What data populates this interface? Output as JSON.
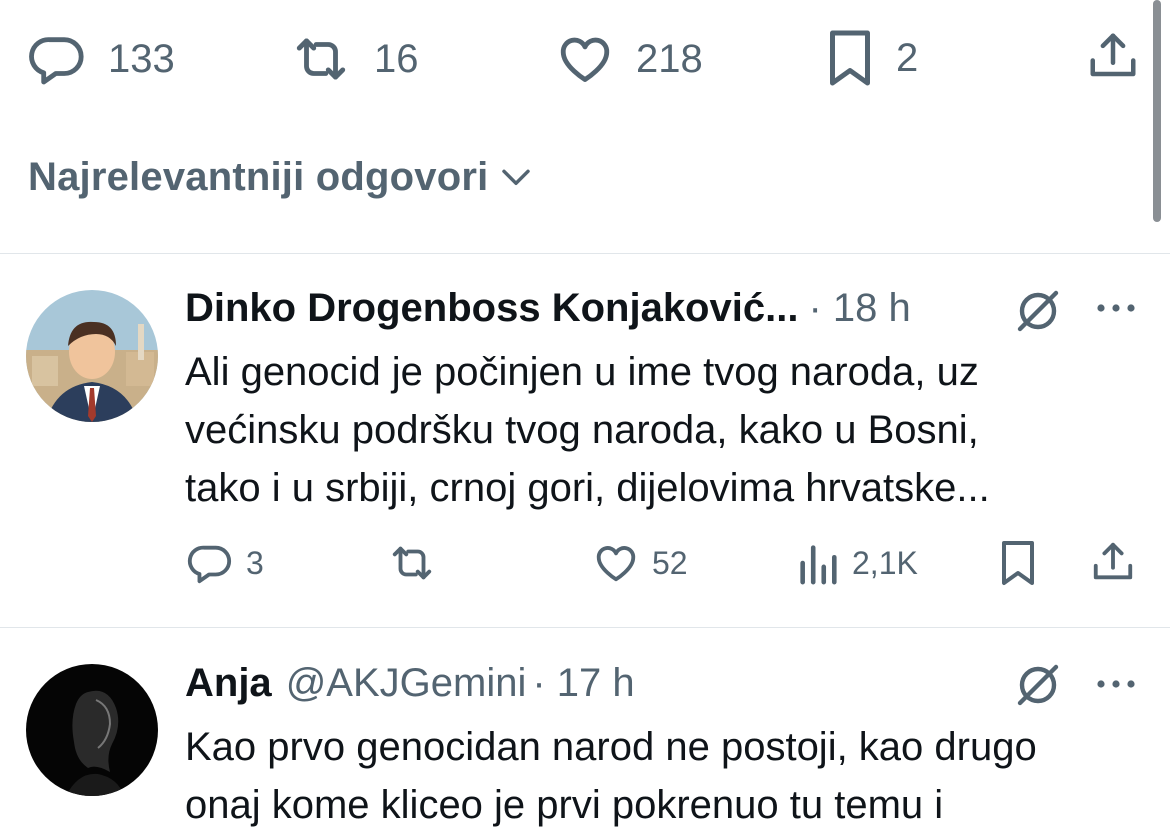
{
  "main_actions": {
    "replies": "133",
    "reposts": "16",
    "likes": "218",
    "bookmarks": "2"
  },
  "sort": {
    "label": "Najrelevantniji odgovori"
  },
  "replies": [
    {
      "display_name": "Dinko Drogenboss Konjaković...",
      "time": "· 18 h",
      "text_lines": [
        "Ali genocid je počinjen u ime tvog naroda, uz",
        "većinsku podršku tvog naroda, kako u Bosni,",
        "tako i u srbiji, crnoj gori, dijelovima hrvatske..."
      ],
      "replies": "3",
      "reposts": "",
      "likes": "52",
      "views": "2,1K"
    },
    {
      "display_name": "Anja",
      "handle": "@AKJGemini",
      "time": "· 17 h",
      "text_lines": [
        "Kao prvo genocidan narod ne postoji, kao drugo",
        "onaj kome kliceo je prvi pokrenuo tu temu i"
      ]
    }
  ],
  "colors": {
    "text": "#0f1419",
    "secondary": "#536471",
    "divider": "#e1e6ea"
  },
  "icons": [
    "reply-icon",
    "repost-icon",
    "like-icon",
    "bookmark-icon",
    "share-icon",
    "chevron-down-icon",
    "grok-icon",
    "more-icon",
    "views-icon"
  ]
}
